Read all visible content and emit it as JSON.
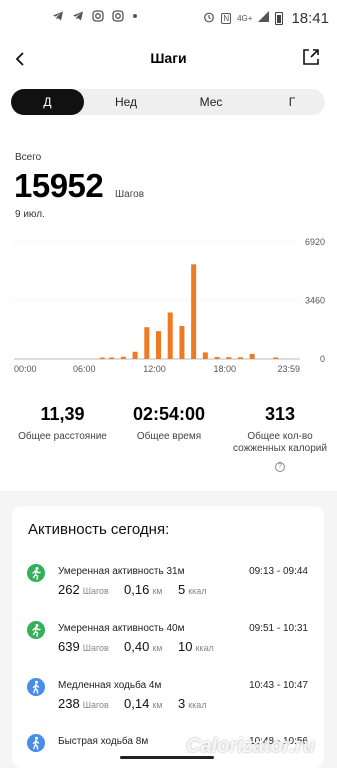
{
  "status": {
    "time": "18:41",
    "network": "4G+",
    "nfc": "N"
  },
  "header": {
    "title": "Шаги"
  },
  "tabs": [
    {
      "label": "Д",
      "active": true
    },
    {
      "label": "Нед",
      "active": false
    },
    {
      "label": "Мес",
      "active": false
    },
    {
      "label": "Г",
      "active": false
    }
  ],
  "summary": {
    "label": "Всего",
    "value": "15952",
    "unit": "Шагов",
    "date": "9 июл."
  },
  "chart_data": {
    "type": "bar",
    "x_ticks": [
      "00:00",
      "06:00",
      "12:00",
      "18:00",
      "23:59"
    ],
    "y_ticks": [
      "6920",
      "3460",
      "0"
    ],
    "ylim": [
      0,
      6920
    ],
    "bar_color": "#f07a22",
    "bars": [
      {
        "hour": 7.2,
        "value": 40
      },
      {
        "hour": 8.0,
        "value": 90
      },
      {
        "hour": 9.0,
        "value": 130
      },
      {
        "hour": 10.0,
        "value": 430
      },
      {
        "hour": 11.0,
        "value": 1880
      },
      {
        "hour": 12.0,
        "value": 1650
      },
      {
        "hour": 13.0,
        "value": 2750
      },
      {
        "hour": 14.0,
        "value": 1950
      },
      {
        "hour": 15.0,
        "value": 5600
      },
      {
        "hour": 16.0,
        "value": 390
      },
      {
        "hour": 17.0,
        "value": 120
      },
      {
        "hour": 18.0,
        "value": 110
      },
      {
        "hour": 19.0,
        "value": 100
      },
      {
        "hour": 20.0,
        "value": 300
      },
      {
        "hour": 21.0,
        "value": 0
      },
      {
        "hour": 22.0,
        "value": 50
      }
    ]
  },
  "stats": [
    {
      "value": "11,39",
      "label": "Общее расстояние"
    },
    {
      "value": "02:54:00",
      "label": "Общее время"
    },
    {
      "value": "313",
      "label": "Общее кол-во сожженных калорий"
    }
  ],
  "activity": {
    "title": "Активность сегодня:",
    "items": [
      {
        "name": "Умеренная активность 31м",
        "time": "09:13 - 09:44",
        "steps": "262",
        "steps_unit": "Шагов",
        "km": "0,16",
        "km_unit": "км",
        "kcal": "5",
        "kcal_unit": "ккал",
        "icon": "running-person-icon",
        "color": "#34b05a"
      },
      {
        "name": "Умеренная активность 40м",
        "time": "09:51 - 10:31",
        "steps": "639",
        "steps_unit": "Шагов",
        "km": "0,40",
        "km_unit": "км",
        "kcal": "10",
        "kcal_unit": "ккал",
        "icon": "running-person-icon",
        "color": "#34b05a"
      },
      {
        "name": "Медленная ходьба 4м",
        "time": "10:43 - 10:47",
        "steps": "238",
        "steps_unit": "Шагов",
        "km": "0,14",
        "km_unit": "км",
        "kcal": "3",
        "kcal_unit": "ккал",
        "icon": "walking-person-icon",
        "color": "#4a8de8"
      },
      {
        "name": "Быстрая ходьба 8м",
        "time": "10:48 - 10:56",
        "steps": "",
        "steps_unit": "",
        "km": "",
        "km_unit": "",
        "kcal": "",
        "kcal_unit": "",
        "icon": "walking-person-icon",
        "color": "#4a8de8"
      }
    ]
  },
  "watermark": "Calorizator.ru"
}
